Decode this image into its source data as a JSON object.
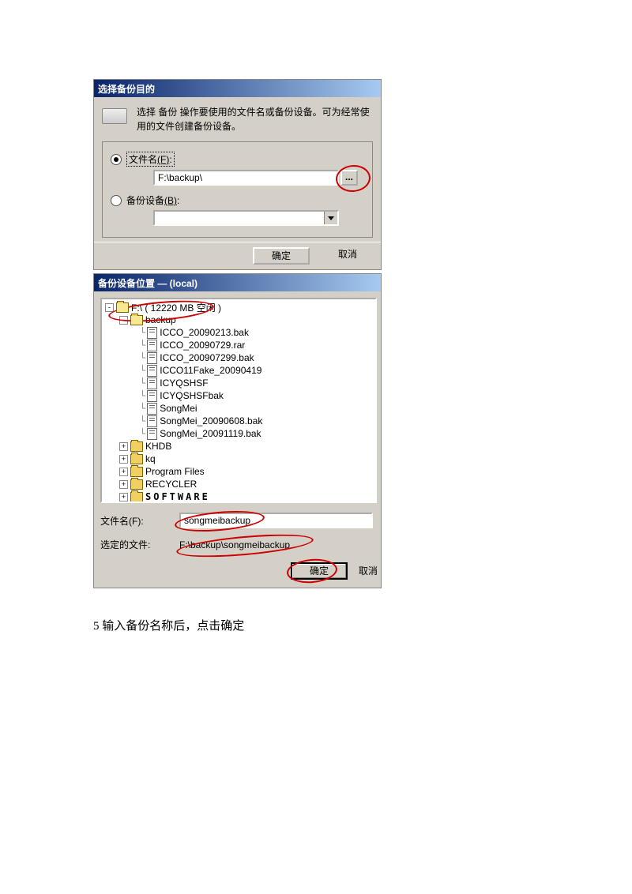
{
  "dialog1": {
    "title": "选择备份目的",
    "description": "选择 备份 操作要使用的文件名或备份设备。可为经常使用的文件创建备份设备。",
    "radio_filename_label": "文件名",
    "radio_filename_accel": "(F)",
    "radio_filename_boxed": ":",
    "filename_value": "F:\\backup\\",
    "browse_label": "...",
    "radio_device_label": "备份设备",
    "radio_device_accel": "(B)",
    "radio_device_colon": ":",
    "ok": "确定",
    "cancel": "取消"
  },
  "dialog2": {
    "title": "备份设备位置 — (local)",
    "root_label": "F:\\ ( 12220 MB 空闲 )",
    "backup_folder": "backup",
    "files": [
      "ICCO_20090213.bak",
      "ICCO_20090729.rar",
      "ICCO_200907299.bak",
      "ICCO11Fake_20090419",
      "ICYQSHSF",
      "ICYQSHSFbak",
      "SongMei",
      "SongMei_20090608.bak",
      "SongMei_20091119.bak"
    ],
    "folders": [
      "KHDB",
      "kq",
      "Program Files",
      "RECYCLER"
    ],
    "software_folder": "SOFTWARE",
    "file_label": "文件名(F):",
    "file_value": "songmeibackup",
    "selected_label": "选定的文件:",
    "selected_value": "F:\\backup\\songmeibackup",
    "ok": "确定",
    "cancel": "取消"
  },
  "caption": "5 输入备份名称后，点击确定"
}
